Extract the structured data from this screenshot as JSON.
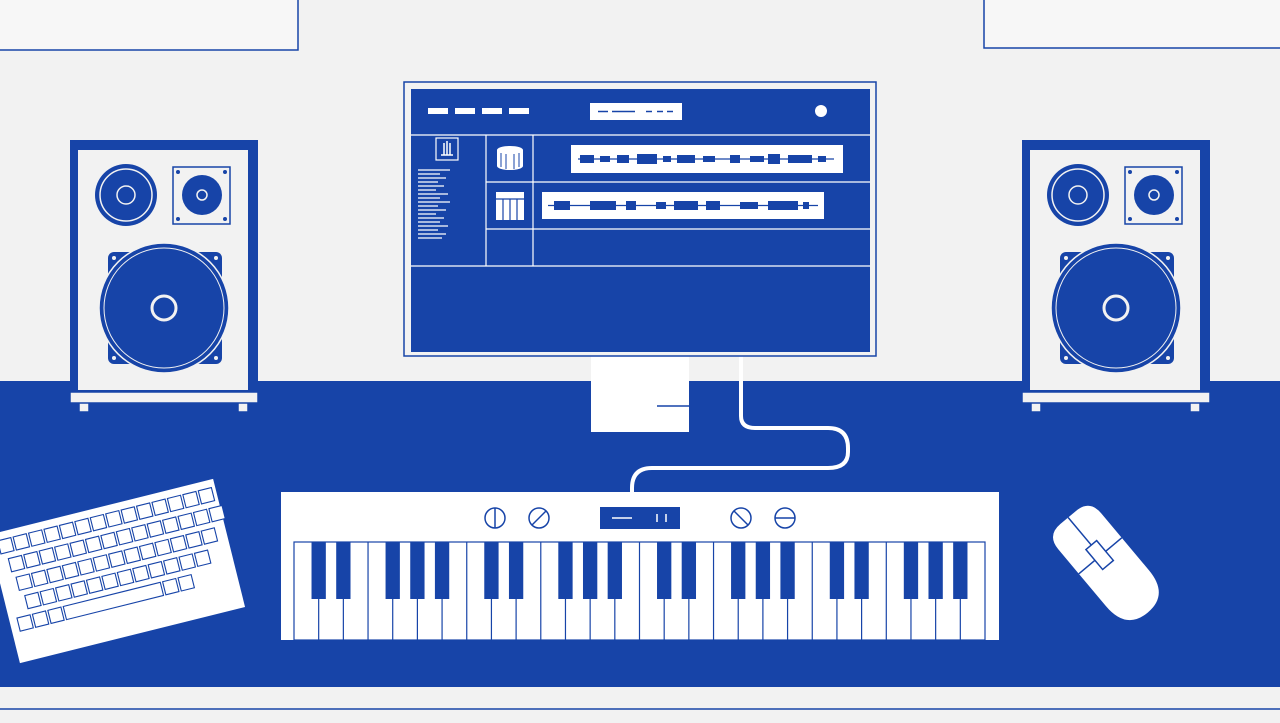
{
  "illustration": {
    "subject": "music-production-desk",
    "colors": {
      "primary": "#1744a8",
      "background": "#f2f2f2",
      "white": "#ffffff"
    },
    "icons": [
      "speaker-icon",
      "drum-icon",
      "piano-keys-icon",
      "metronome-icon",
      "knob-icon",
      "mouse-icon",
      "keyboard-icon"
    ],
    "keyboard_keys": {
      "white_keys": 28,
      "black_keys": 20
    },
    "daw_tracks": 2
  }
}
